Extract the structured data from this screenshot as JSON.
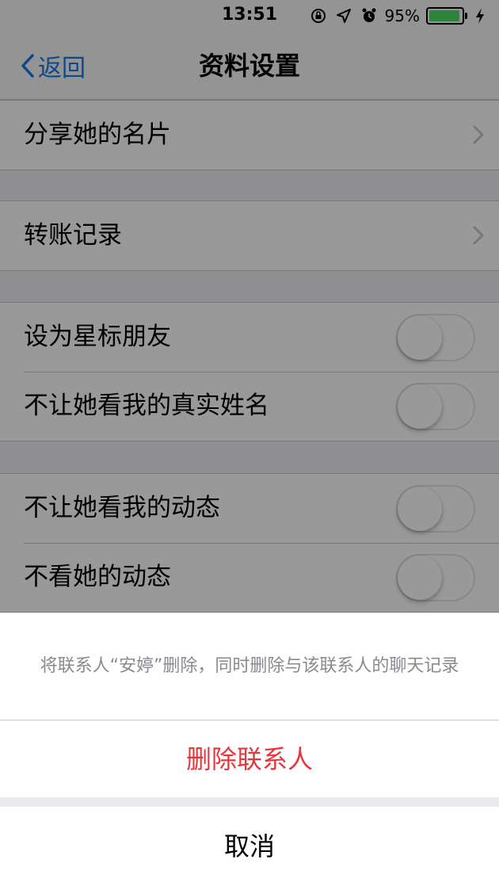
{
  "status_bar": {
    "time": "13:51",
    "battery_percent": "95%",
    "battery_level": 0.95,
    "icons": [
      "orientation-lock-icon",
      "location-arrow-icon",
      "alarm-icon",
      "battery-icon",
      "charging-bolt-icon"
    ]
  },
  "nav": {
    "back_label": "返回",
    "title": "资料设置"
  },
  "groups": {
    "share": {
      "label": "分享她的名片"
    },
    "transfer": {
      "label": "转账记录"
    },
    "star": {
      "label": "设为星标朋友",
      "on": false
    },
    "hide_real_name": {
      "label": "不让她看我的真实姓名",
      "on": false
    },
    "hide_my_moments": {
      "label": "不让她看我的动态",
      "on": false
    },
    "hide_her_moments": {
      "label": "不看她的动态",
      "on": false
    }
  },
  "action_sheet": {
    "message": "将联系人“安婷”删除，同时删除与该联系人的聊天记录",
    "destructive_label": "删除联系人",
    "cancel_label": "取消"
  },
  "colors": {
    "accent_blue": "#1478e6",
    "destructive_red": "#e6353b",
    "battery_green": "#4cd964"
  }
}
